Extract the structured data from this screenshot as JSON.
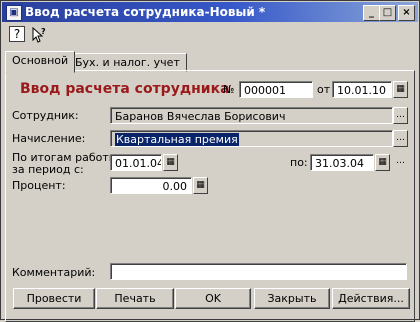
{
  "window": {
    "title": "Ввод расчета сотрудника-Новый *"
  },
  "toolbar": {
    "help_icon": "?",
    "pointer_icon": "pointer-question-icon"
  },
  "tabs": [
    {
      "label": "Основной",
      "active": true
    },
    {
      "label": "Бух. и налог. учет",
      "active": false
    }
  ],
  "form": {
    "heading": "Ввод расчета сотрудника",
    "number_label": "№",
    "number_value": "000001",
    "from_label": "от",
    "date_value": "10.01.10",
    "employee_label": "Сотрудник:",
    "employee_value": "Баранов Вячеслав Борисович",
    "accrual_label": "Начисление:",
    "accrual_value": "Квартальная премия",
    "period_label_1": "По итогам работы",
    "period_label_2": "за период с:",
    "period_from_value": "01.01.04",
    "period_to_label": "по:",
    "period_to_value": "31.03.04",
    "percent_label": "Процент:",
    "percent_value": "0.00",
    "comment_label": "Комментарий:",
    "comment_value": ""
  },
  "buttons": {
    "post": "Провести",
    "print": "Печать",
    "ok": "OK",
    "close": "Закрыть",
    "actions": "Действия..."
  }
}
